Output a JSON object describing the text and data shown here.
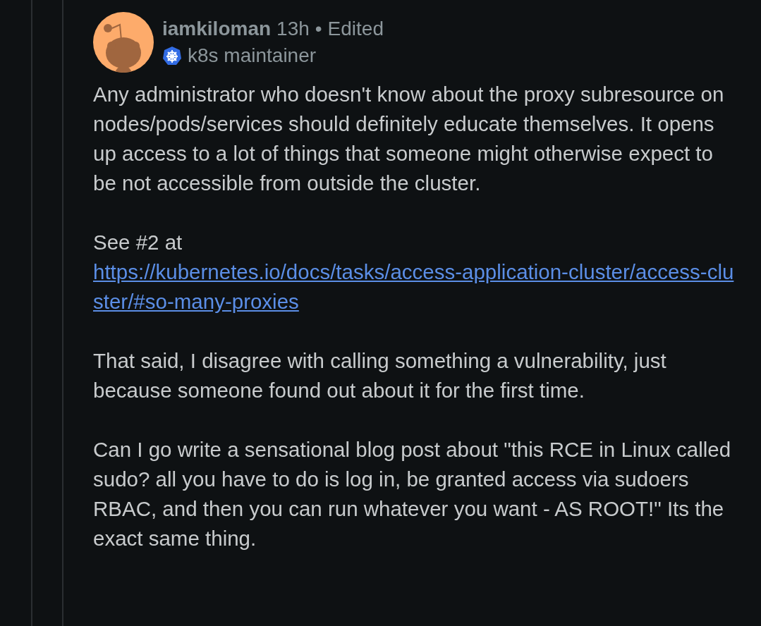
{
  "comment": {
    "author": "iamkiloman",
    "time": "13h",
    "separator": "•",
    "edited": "Edited",
    "flair": "k8s maintainer",
    "paragraphs": [
      {
        "kind": "text",
        "text": "Any administrator who doesn't know about the proxy subresource on nodes/pods/services should definitely educate themselves. It opens up access to a lot of things that someone might otherwise expect to be not accessible from outside the cluster."
      },
      {
        "kind": "link",
        "text": "See #2 at",
        "link": "https://kubernetes.io/docs/tasks/access-application-cluster/access-cluster/#so-many-proxies"
      },
      {
        "kind": "text",
        "text": "That said, I disagree with calling something a vulnerability, just because someone found out about it for the first time."
      },
      {
        "kind": "text",
        "text": "Can I go write a sensational blog post about \"this RCE in Linux called sudo? all you have to do is log in, be granted access via sudoers RBAC, and then you can run whatever you want - AS ROOT!\" Its the exact same thing."
      }
    ]
  }
}
